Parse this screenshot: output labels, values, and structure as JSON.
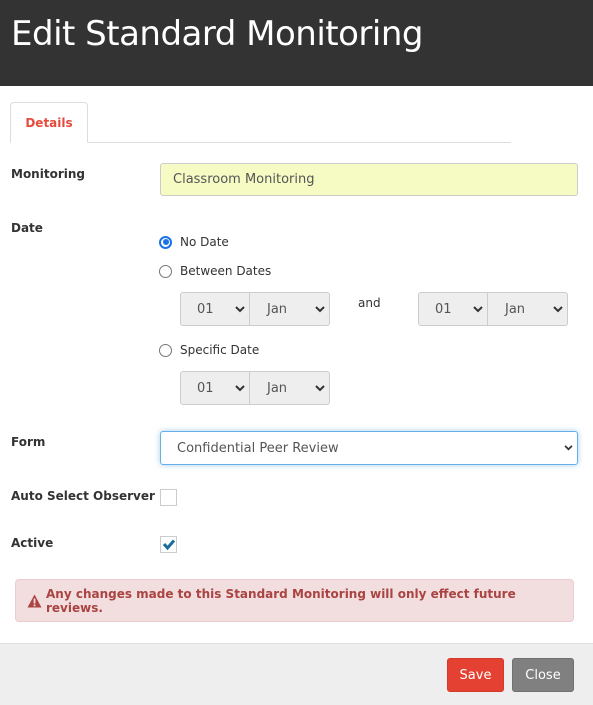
{
  "header": {
    "title": "Edit Standard Monitoring"
  },
  "tabs": [
    {
      "label": "Details",
      "active": true
    }
  ],
  "fields": {
    "monitoring": {
      "label": "Monitoring",
      "value": "Classroom Monitoring"
    },
    "date": {
      "label": "Date",
      "options": [
        {
          "label": "No Date",
          "checked": true
        },
        {
          "label": "Between Dates",
          "checked": false
        },
        {
          "label": "Specific Date",
          "checked": false
        }
      ],
      "between": {
        "from": {
          "day": "01",
          "month": "Jan"
        },
        "joiner": "and",
        "to": {
          "day": "01",
          "month": "Jan"
        }
      },
      "specific": {
        "day": "01",
        "month": "Jan"
      }
    },
    "form": {
      "label": "Form",
      "value": "Confidential Peer Review"
    },
    "auto_select_observer": {
      "label": "Auto Select Observer",
      "checked": false
    },
    "active": {
      "label": "Active",
      "checked": true
    }
  },
  "alert": {
    "icon": "warning-triangle-icon",
    "text": "Any changes made to this Standard Monitoring will only effect future reviews."
  },
  "footer": {
    "save_label": "Save",
    "close_label": "Close"
  },
  "colors": {
    "accent": "#e54b3c",
    "header_bg": "#333333",
    "alert_text": "#a94442",
    "check": "#1a6e99"
  }
}
